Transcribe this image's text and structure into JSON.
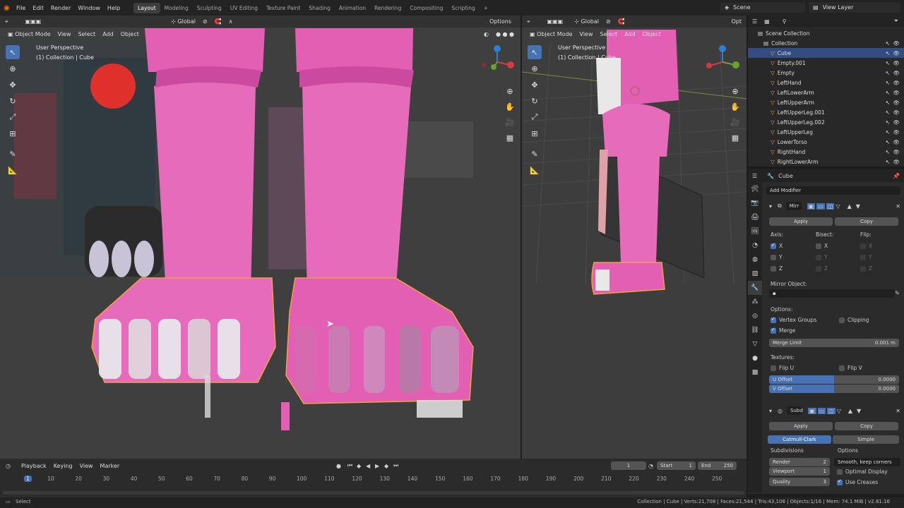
{
  "app": {
    "menus": [
      "File",
      "Edit",
      "Render",
      "Window",
      "Help"
    ],
    "workspaces": [
      "Layout",
      "Modeling",
      "Sculpting",
      "UV Editing",
      "Texture Paint",
      "Shading",
      "Animation",
      "Rendering",
      "Compositing",
      "Scripting"
    ],
    "active_workspace": "Layout",
    "scene": "Scene",
    "view_layer": "View Layer"
  },
  "left_viewport": {
    "mode": "Object Mode",
    "menu": [
      "View",
      "Select",
      "Add",
      "Object"
    ],
    "orientation": "Global",
    "options": "Options",
    "perspective": "User Perspective",
    "collection": "(1) Collection | Cube"
  },
  "right_viewport": {
    "mode": "Object Mode",
    "menu": [
      "View",
      "Select",
      "Add",
      "Object"
    ],
    "orientation": "Global",
    "options": "Opt",
    "perspective": "User Perspective",
    "collection": "(1) Collection | Cube"
  },
  "outliner": {
    "root": "Scene Collection",
    "items": [
      {
        "name": "Collection",
        "selected": false
      },
      {
        "name": "Cube",
        "selected": true
      },
      {
        "name": "Empty.001",
        "selected": false
      },
      {
        "name": "Empty",
        "selected": false
      },
      {
        "name": "LeftHand",
        "selected": false
      },
      {
        "name": "LeftLowerArm",
        "selected": false
      },
      {
        "name": "LeftUpperArm",
        "selected": false
      },
      {
        "name": "LeftUpperLeg.001",
        "selected": false
      },
      {
        "name": "LeftUpperLeg.002",
        "selected": false
      },
      {
        "name": "LeftUpperLeg",
        "selected": false
      },
      {
        "name": "LowerTorso",
        "selected": false
      },
      {
        "name": "RightHand",
        "selected": false
      },
      {
        "name": "RightLowerArm",
        "selected": false
      }
    ]
  },
  "properties": {
    "object": "Cube",
    "add_modifier": "Add Modifier",
    "mirror": {
      "name": "Mirr",
      "apply": "Apply",
      "copy": "Copy",
      "axis_label": "Axis:",
      "bisect_label": "Bisect:",
      "flip_label": "Flip:",
      "axes": [
        "X",
        "Y",
        "Z"
      ],
      "mirror_object_label": "Mirror Object:",
      "options_label": "Options:",
      "vertex_groups": "Vertex Groups",
      "clipping": "Clipping",
      "merge": "Merge",
      "merge_limit_label": "Merge Limit",
      "merge_limit": "0.001 m",
      "textures_label": "Textures:",
      "flip_u": "Flip U",
      "flip_v": "Flip V",
      "u_offset_label": "U Offset",
      "u_offset": "0.0000",
      "v_offset_label": "V Offset",
      "v_offset": "0.0000"
    },
    "subsurf": {
      "name": "Subd",
      "apply": "Apply",
      "copy": "Copy",
      "catmull": "Catmull-Clark",
      "simple": "Simple",
      "subdivisions_label": "Subdivisions",
      "options_label": "Options",
      "render_label": "Render",
      "render": "2",
      "viewport_label": "Viewport",
      "viewport": "1",
      "quality_label": "Quality",
      "quality": "3",
      "uv_smooth": "Smooth, keep corners",
      "optimal_display": "Optimal Display",
      "use_creases": "Use Creases"
    }
  },
  "timeline": {
    "menus": [
      "Playback",
      "Keying",
      "View",
      "Marker"
    ],
    "current_frame": "1",
    "start_label": "Start",
    "start": "1",
    "end_label": "End",
    "end": "250",
    "ticks": [
      "1",
      "10",
      "20",
      "30",
      "40",
      "50",
      "60",
      "70",
      "80",
      "90",
      "100",
      "110",
      "120",
      "130",
      "140",
      "150",
      "160",
      "170",
      "180",
      "190",
      "200",
      "210",
      "220",
      "230",
      "240",
      "250"
    ]
  },
  "status": {
    "left": "Select",
    "right": "Collection | Cube | Verts:21,708 | Faces:21,544 | Tris:43,108 | Objects:1/16 | Mem: 74.1 MiB | v2.81.16"
  },
  "colors": {
    "accent": "#4772b3",
    "pink": "#e25fb3",
    "bg": "#3d3d3d"
  }
}
